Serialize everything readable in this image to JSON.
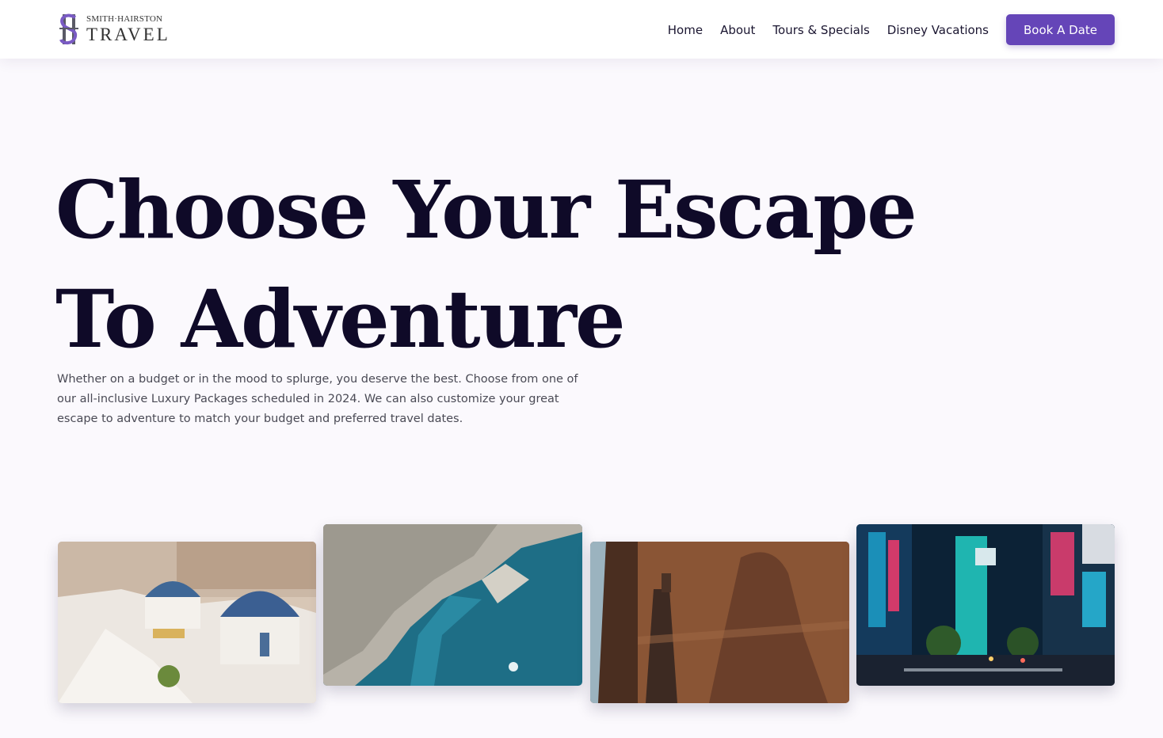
{
  "brand": {
    "line1": "SMITH·HAIRSTON",
    "line2": "TRAVEL",
    "accent_color": "#6545b8"
  },
  "nav": {
    "items": [
      {
        "label": "Home"
      },
      {
        "label": "About"
      },
      {
        "label": "Tours & Specials"
      },
      {
        "label": "Disney Vacations"
      }
    ],
    "cta_label": "Book A Date"
  },
  "hero": {
    "title": "Choose Your Escape To Adventure",
    "body": "Whether on a budget or in the mood to splurge, you deserve the best. Choose from one of our all-inclusive Luxury Packages scheduled in 2024. We can also customize your great escape to adventure to match your budget and preferred travel dates."
  },
  "gallery": [
    {
      "subject": "santorini-photo"
    },
    {
      "subject": "coastal-city-aerial-photo"
    },
    {
      "subject": "egyptian-temple-photo"
    },
    {
      "subject": "tokyo-street-night-photo"
    }
  ]
}
